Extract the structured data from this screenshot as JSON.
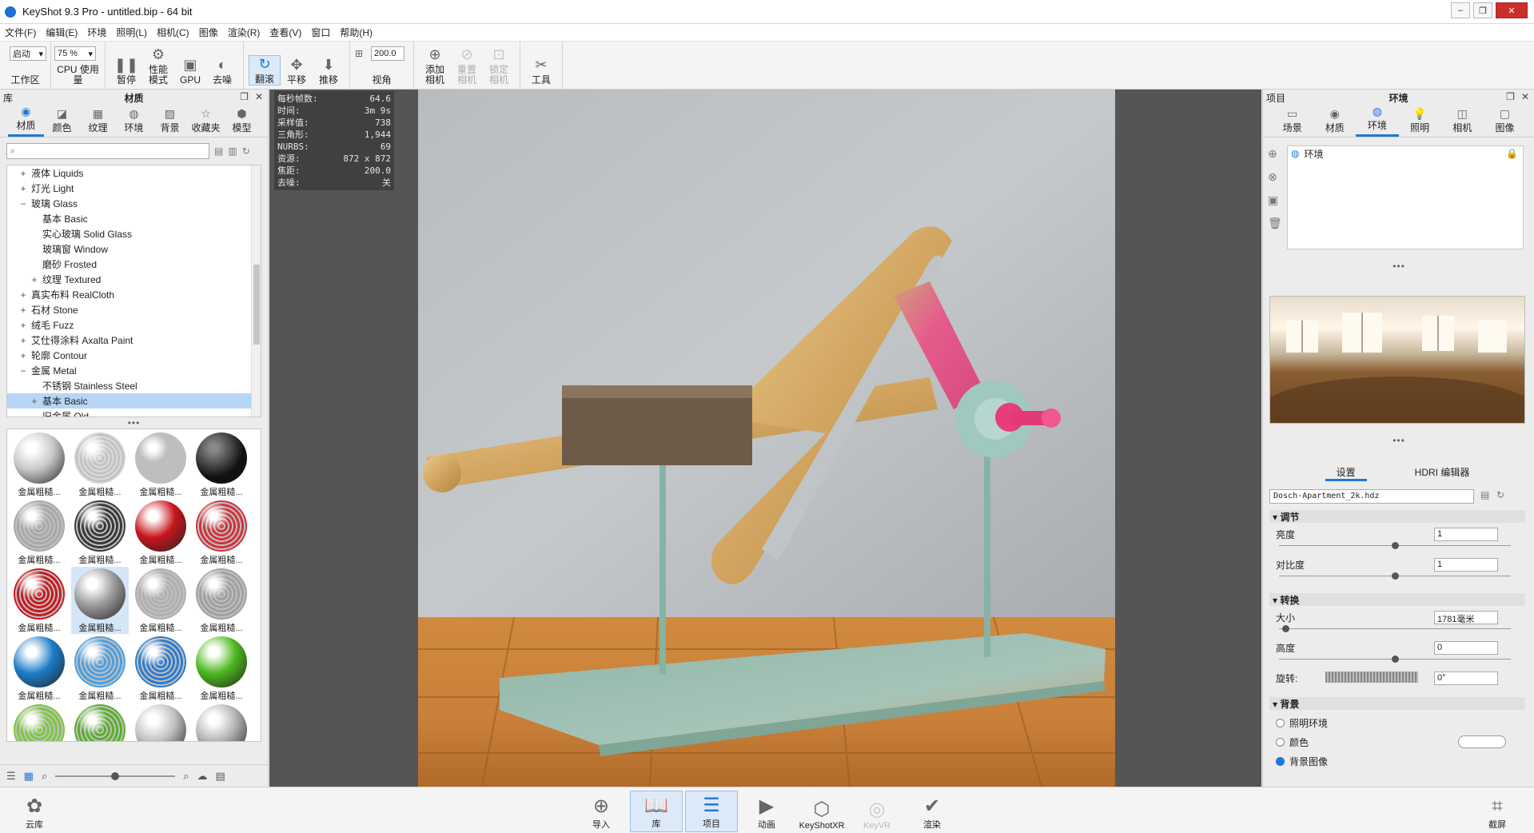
{
  "window": {
    "title": "KeyShot 9.3 Pro - untitled.bip - 64 bit"
  },
  "menu": [
    "文件(F)",
    "编辑(E)",
    "环境",
    "照明(L)",
    "相机(C)",
    "图像",
    "渲染(R)",
    "查看(V)",
    "窗口",
    "帮助(H)"
  ],
  "toolbar": {
    "workspace_value": "启动",
    "workspace_label": "工作区",
    "cpu_value": "75 %",
    "cpu_label": "CPU 使用量",
    "pause": "暂停",
    "perf_mode": "性能\n模式",
    "gpu": "GPU",
    "denoise": "去噪",
    "tumble": "翻滚",
    "pan": "平移",
    "dolly": "推移",
    "fov_value": "200.0",
    "fov_label": "视角",
    "add_camera": "添加\n相机",
    "reset_camera": "重置\n相机",
    "lock_camera": "锁定\n相机",
    "tools": "工具"
  },
  "library": {
    "panel_label": "库",
    "title": "材质",
    "tabs": [
      "材质",
      "颜色",
      "纹理",
      "环境",
      "背景",
      "收藏夹",
      "模型"
    ],
    "search_placeholder": "",
    "tree": [
      {
        "label": "液体 Liquids",
        "indent": 0,
        "toggle": "+"
      },
      {
        "label": "灯光 Light",
        "indent": 0,
        "toggle": "+"
      },
      {
        "label": "玻璃 Glass",
        "indent": 0,
        "toggle": "−"
      },
      {
        "label": "基本 Basic",
        "indent": 1,
        "toggle": ""
      },
      {
        "label": "实心玻璃 Solid Glass",
        "indent": 1,
        "toggle": ""
      },
      {
        "label": "玻璃窗 Window",
        "indent": 1,
        "toggle": ""
      },
      {
        "label": "磨砂 Frosted",
        "indent": 1,
        "toggle": ""
      },
      {
        "label": "纹理 Textured",
        "indent": 1,
        "toggle": "+"
      },
      {
        "label": "真实布料 RealCloth",
        "indent": 0,
        "toggle": "+"
      },
      {
        "label": "石材 Stone",
        "indent": 0,
        "toggle": "+"
      },
      {
        "label": "绒毛 Fuzz",
        "indent": 0,
        "toggle": "+"
      },
      {
        "label": "艾仕得涂料 Axalta Paint",
        "indent": 0,
        "toggle": "+"
      },
      {
        "label": "轮廓 Contour",
        "indent": 0,
        "toggle": "+"
      },
      {
        "label": "金属 Metal",
        "indent": 0,
        "toggle": "−"
      },
      {
        "label": "不锈钢 Stainless Steel",
        "indent": 1,
        "toggle": ""
      },
      {
        "label": "基本 Basic",
        "indent": 1,
        "toggle": "+",
        "selected": true
      },
      {
        "label": "旧金属 Old",
        "indent": 1,
        "toggle": ""
      }
    ],
    "thumb_label": "金属粗糙...",
    "thumbs": [
      {
        "color": "#c8c8c8",
        "style": "chrome"
      },
      {
        "color": "#d6d6d6",
        "style": "mesh"
      },
      {
        "color": "#bdbdbd",
        "style": "mesh"
      },
      {
        "color": "#2a2a2a",
        "style": "dark"
      },
      {
        "color": "#a8a8a8",
        "style": "mesh"
      },
      {
        "color": "#3a3a3a",
        "style": "mesh"
      },
      {
        "color": "#c8141c",
        "style": "chrome"
      },
      {
        "color": "#d0343c",
        "style": "mesh"
      },
      {
        "color": "#c81a22",
        "style": "mesh"
      },
      {
        "color": "#9a9a9a",
        "style": "chrome",
        "selected": true
      },
      {
        "color": "#b0b0b0",
        "style": "mesh"
      },
      {
        "color": "#a0a0a0",
        "style": "mesh"
      },
      {
        "color": "#1c7cc8",
        "style": "chrome"
      },
      {
        "color": "#4aa0e0",
        "style": "mesh"
      },
      {
        "color": "#2c7ccc",
        "style": "mesh"
      },
      {
        "color": "#4cb81c",
        "style": "chrome"
      },
      {
        "color": "#7cc83c",
        "style": "mesh"
      },
      {
        "color": "#58b028",
        "style": "mesh"
      },
      {
        "color": "#c0c0c0",
        "style": "chrome"
      },
      {
        "color": "#b4b4b4",
        "style": "chrome"
      }
    ]
  },
  "hud": [
    {
      "k": "每秒帧数:",
      "v": "64.6"
    },
    {
      "k": "时间:",
      "v": "3m 9s"
    },
    {
      "k": "采样值:",
      "v": "738"
    },
    {
      "k": "三角形:",
      "v": "1,944"
    },
    {
      "k": "NURBS:",
      "v": "69"
    },
    {
      "k": "资源:",
      "v": "872 x 872"
    },
    {
      "k": "焦距:",
      "v": "200.0"
    },
    {
      "k": "去噪:",
      "v": "关"
    }
  ],
  "project": {
    "panel_label": "项目",
    "title": "环境",
    "tabs": [
      "场景",
      "材质",
      "环境",
      "照明",
      "相机",
      "图像"
    ],
    "env_item": "环境",
    "subtabs": [
      "设置",
      "HDRI 编辑器"
    ],
    "hdr_file": "Dosch-Apartment_2k.hdz",
    "sections": {
      "adjust": "调节",
      "transform": "转换",
      "background": "背景"
    },
    "brightness": {
      "label": "亮度",
      "value": "1"
    },
    "contrast": {
      "label": "对比度",
      "value": "1"
    },
    "size": {
      "label": "大小",
      "value": "1781毫米"
    },
    "height": {
      "label": "高度",
      "value": "0"
    },
    "rotation": {
      "label": "旋转:",
      "value": "0°"
    },
    "bg_options": [
      {
        "label": "照明环境",
        "checked": false
      },
      {
        "label": "颜色",
        "checked": false
      },
      {
        "label": "背景图像",
        "checked": true
      }
    ]
  },
  "bottom": {
    "cloud": "云库",
    "import": "导入",
    "library": "库",
    "project": "项目",
    "animation": "动画",
    "keyshotxr": "KeyShotXR",
    "keyvr": "KeyVR",
    "render": "渲染",
    "screenshot": "截屏"
  }
}
